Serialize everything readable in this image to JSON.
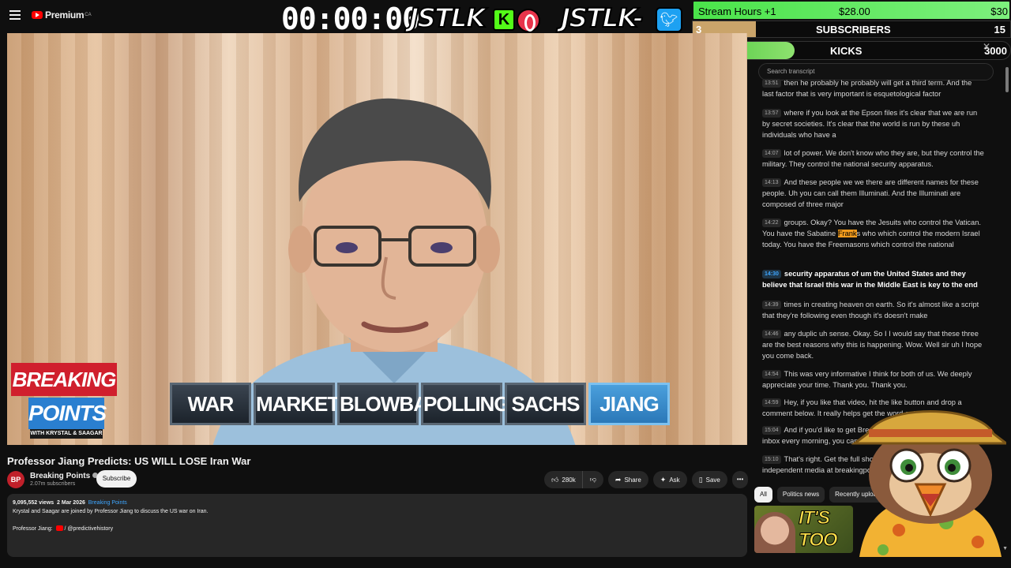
{
  "header": {
    "logo_text": "Premium",
    "logo_region": "CA",
    "timer": "00:00:00",
    "brand_left": "JSTLK",
    "brand_right": "JSTLK",
    "brand_right_suffix": "-",
    "kick_badge": "K"
  },
  "stream_stats": {
    "hours_label": "Stream Hours +1",
    "hours_amount": "$28.00",
    "hours_goal": "$30",
    "hours_progress": 0.93,
    "subs_current": "3",
    "subs_label": "SUBSCRIBERS",
    "subs_goal": "15",
    "subs_progress": 0.2,
    "kicks_current": "1001",
    "kicks_label": "KICKS",
    "kicks_goal": "3000",
    "kicks_progress": 0.33
  },
  "video": {
    "overlay_breaking": "BREAKING",
    "overlay_points": "POINTS",
    "overlay_sub": "WITH KRYSTAL & SAAGAR",
    "topics": [
      "WAR",
      "MARKETS",
      "BLOWBACK",
      "POLLING",
      "SACHS",
      "JIANG"
    ],
    "active_topic": "JIANG"
  },
  "details": {
    "title": "Professor Jiang Predicts: US WILL LOSE Iran War",
    "channel_avatar": "BP",
    "channel_name": "Breaking Points",
    "channel_subs": "2.07m subscribers",
    "subscribe_label": "Subscribe",
    "likes": "280k",
    "share_label": "Share",
    "ask_label": "Ask",
    "save_label": "Save",
    "more_label": "•••",
    "views": "9,095,552 views",
    "date": "2 Mar 2026",
    "hashtag": "Breaking Points",
    "desc_line1": "Krystal and Saagar are joined by Professor Jiang to discuss the US war on Iran.",
    "desc_guest_label": "Professor Jiang:",
    "desc_guest_handle": "/ @predictivehistory"
  },
  "transcript": {
    "search_placeholder": "Search transcript",
    "segments": [
      {
        "time": "13:51",
        "text": "then he probably he probably will get a third term. And the last factor that is very important is esquetological factor"
      },
      {
        "time": "13:57",
        "text": "where if you look at the Epson files it's clear that we are run by secret societies. It's clear that the world is run by these uh individuals who have a"
      },
      {
        "time": "14:07",
        "text": "lot of power. We don't know who they are, but they control the military. They control the national security apparatus."
      },
      {
        "time": "14:13",
        "text": "And these people we we there are different names for these people. Uh you can call them Illuminati. And the Illuminati are composed of three major"
      },
      {
        "time": "14:22",
        "text_before": "groups. Okay? You have the Jesuits who control the Vatican. You have the Sabatine ",
        "highlight": "Frank",
        "text_after": "s who which control the modern Israel today. You have the Freemasons which control the national"
      },
      {
        "time": "14:30",
        "text": "security apparatus of um the United States and they believe that Israel this war in the Middle East is key to the end"
      },
      {
        "time": "14:39",
        "text": "times in creating heaven on earth. So it's almost like a script that they're following even though it's doesn't make"
      },
      {
        "time": "14:46",
        "text": "any duplic uh sense. Okay. So I I would say that these three are the best reasons why this is happening. Wow. Well sir uh I hope you come back."
      },
      {
        "time": "14:54",
        "text": "This was very informative I think for both of us. We deeply appreciate your time. Thank you. Thank you."
      },
      {
        "time": "14:59",
        "text": "Hey, if you like that video, hit the like button and drop a comment below. It really helps get the word out."
      },
      {
        "time": "15:04",
        "text": "And if you'd like to get Breaking Points delivered to your inbox every morning, you can become a premium subscriber."
      },
      {
        "time": "15:10",
        "text": "That's right. Get the full show ad free and support independent media at breakingpoints.com"
      }
    ],
    "active_index": 5
  },
  "chips": [
    "All",
    "Politics news",
    "Recently uploaded"
  ],
  "thumbnail_text": "IT'S TOO"
}
